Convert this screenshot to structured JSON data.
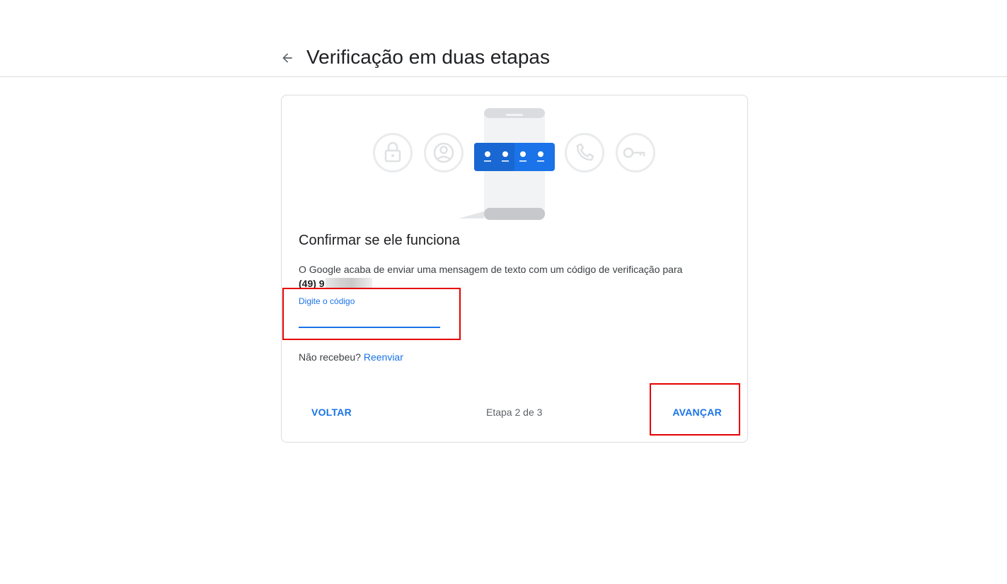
{
  "header": {
    "title": "Verificação em duas etapas",
    "back_icon": "arrow-back-icon"
  },
  "card": {
    "illustration": {
      "icons": [
        "lock-icon",
        "account-circle-icon",
        "password-dots-icon",
        "phone-icon",
        "key-icon"
      ],
      "accent_color": "#1a73e8"
    },
    "title": "Confirmar se ele funciona",
    "description": "O Google acaba de enviar uma mensagem de texto com um código de verificação para",
    "phone_number_visible": "(49) 9",
    "code_field": {
      "label": "Digite o código",
      "value": ""
    },
    "resend_prompt": "Não recebeu?",
    "resend_link": "Reenviar",
    "back_button": "VOLTAR",
    "step_text": "Etapa 2 de 3",
    "next_button": "AVANÇAR"
  },
  "colors": {
    "accent": "#1a73e8",
    "highlight_box": "#e50000",
    "border": "#dadce0"
  }
}
